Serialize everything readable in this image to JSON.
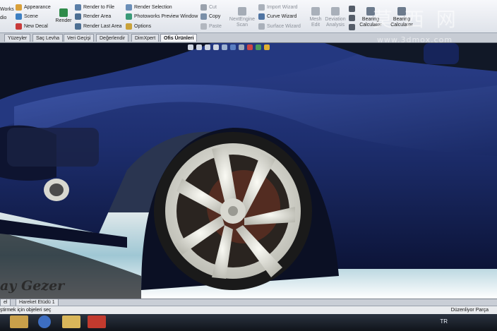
{
  "ribbon": {
    "left_partial": [
      "Works",
      "dio"
    ],
    "render_tools": {
      "appearance": "Appearance",
      "scene": "Scene",
      "new_decal": "New Decal",
      "render": "Render",
      "render_to_file": "Render to File",
      "render_area": "Render Area",
      "render_last_area": "Render Last Area",
      "render_selection": "Render Selection",
      "preview_window": "Photoworks Preview Window",
      "options": "Options"
    },
    "clipboard": {
      "cut": "Cut",
      "copy": "Copy",
      "paste": "Paste"
    },
    "nextengine": {
      "label": "NextEngine",
      "label2": "Scan"
    },
    "curves": {
      "from_file": "Import Wizard",
      "curve_wizard": "Curve Wizard",
      "surface_wizard": "Surface Wizard"
    },
    "mesh": {
      "l1": "Mesh",
      "l2": "Edit"
    },
    "deviation": {
      "l1": "Deviation",
      "l2": "Analysis"
    },
    "bearing1": {
      "l1": "Bearing",
      "l2": "Calculator"
    },
    "bearing2": {
      "l1": "Bearing",
      "l2": "Calculator"
    }
  },
  "tabs": [
    "Yüzeyler",
    "Saç Levha",
    "Veri Geçişi",
    "Değerlendir",
    "DimXpert",
    "Ofis Ürünleri"
  ],
  "active_tab": "Ofis Ürünleri",
  "watermark": {
    "main": "莫 西 网",
    "sub": "www.3dmox.com"
  },
  "signature": "ay Gezer",
  "bottom_tabs": [
    "el",
    "Hareket Etüdü 1"
  ],
  "status": {
    "left": "ştirmek için objeleri seç",
    "right": "Düzenliyor Parça"
  },
  "taskbar": {
    "lang": "TR"
  },
  "colors": {
    "car_body": "#1c2d6b",
    "rim": "#e8e8e0",
    "ribbon_bg": "#eef0f4"
  }
}
